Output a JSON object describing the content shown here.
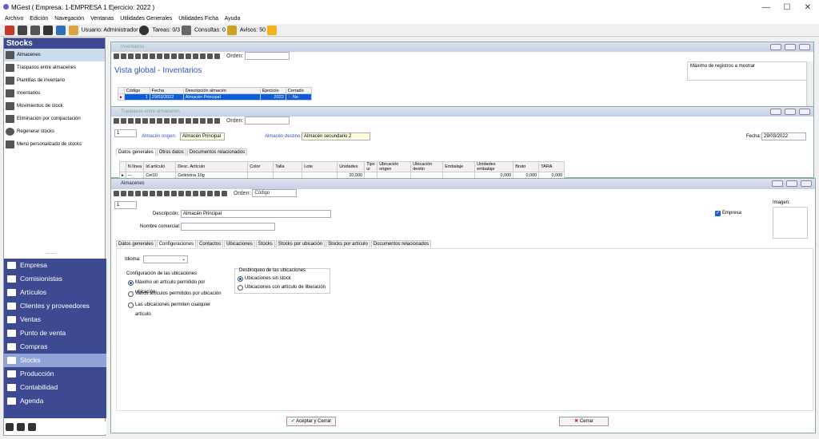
{
  "window": {
    "title": "MGest ( Empresa: 1-EMPRESA 1 Ejercicio: 2022 )",
    "min": "—",
    "max": "☐",
    "close": "✕"
  },
  "menu": [
    "Archivo",
    "Edición",
    "Navegación",
    "Ventanas",
    "Utilidades Generales",
    "Utilidades Ficha",
    "Ayuda"
  ],
  "status": {
    "usuario": "Usuario: Administrador",
    "tareas": "Tareas: 0/3",
    "consultas": "Consultas: 0",
    "avisos": "Avisos: 50"
  },
  "sidebar": {
    "header": "Stocks",
    "items": [
      "Almacenes",
      "Traspasos entre almacenes",
      "Plantillas de inventario",
      "Inventarios",
      "Movimientos de stock",
      "Eliminación por compactación",
      "Regenerar stocks",
      "Menú personalizado de stocks"
    ],
    "modules": [
      "Empresa",
      "Comisionistas",
      "Artículos",
      "Clientes y proveedores",
      "Ventas",
      "Punto de venta",
      "Compras",
      "Stocks",
      "Producción",
      "Contabilidad",
      "Agenda"
    ],
    "dots": "........"
  },
  "inventarios": {
    "title": "Inventarios",
    "orden_label": "Orden:",
    "heading": "Vista global - Inventarios",
    "max_label": "Máximo de registros a mostrar",
    "columns": [
      "Código",
      "Fecha",
      "Descripción almacén",
      "Ejercicio",
      "Cerrado"
    ],
    "row": {
      "codigo": "1",
      "fecha": "29/03/2022",
      "descripcion": "Almacén Principal",
      "ejercicio": "2022",
      "cerrado": "No"
    }
  },
  "traspasos": {
    "title": "Traspasos entre almacenes",
    "orden_label": "Orden:",
    "id": "1",
    "origen_label": "Almacén origen:",
    "origen": "Almacén Principal",
    "destino_label": "Almacén destino:",
    "destino": "Almacén secundario 2",
    "fecha_label": "Fecha:",
    "fecha": "29/03/2022",
    "tabs": [
      "Datos generales",
      "Otros datos",
      "Documentos relacionados"
    ],
    "columns": [
      "N.línea",
      "Id artículo",
      "Desc. Artículo",
      "Color",
      "Talla",
      "Lote",
      "Unidades",
      "Tipo ur",
      "Ubicación origen",
      "Ubicación destin",
      "Embalaje",
      "Unidades embalaje",
      "Bruto",
      "TARA"
    ],
    "row": {
      "linea": "---",
      "id": "Cet10",
      "desc": "Cetirizina 10g",
      "unidades": "20,000",
      "ud_emb": "0,000",
      "bruto": "0,000",
      "tara": "0,000"
    }
  },
  "almacenes": {
    "title": "Almacenes",
    "orden_label": "Orden:",
    "orden_value": "Código",
    "id": "1",
    "descripcion_label": "Descripción:",
    "descripcion": "Almacén Principal",
    "nombre_label": "Nombre comercial:",
    "nombre": "",
    "empresa_label": "Empresa",
    "imagen_label": "Imagen:",
    "tabs": [
      "Datos generales",
      "Configuraciones",
      "Contactos",
      "Ubicaciones",
      "Stocks",
      "Stocks por ubicación",
      "Stocks por artículo",
      "Documentos relacionados"
    ],
    "idioma_label": "Idioma:",
    "config_group": "Configuración de las ubicaciones",
    "config_options": [
      "Máximo un artículo permitido por ubicación",
      "Varios artículos permitidos por ubicación",
      "Las ubicaciones permiten cualquier artículo"
    ],
    "desbloqueo_group": "Desbloqueo de las ubicaciones",
    "desbloqueo_options": [
      "Ubicaciones sin stock",
      "Ubicaciones con artículo de liberación"
    ],
    "aceptar": "Aceptar y Cerrar",
    "cerrar": "Cerrar"
  },
  "colors": {
    "sidebar_bg": "#3d4a91",
    "selected_row": "#0b5ed7",
    "accent_blue": "#3055c0"
  }
}
